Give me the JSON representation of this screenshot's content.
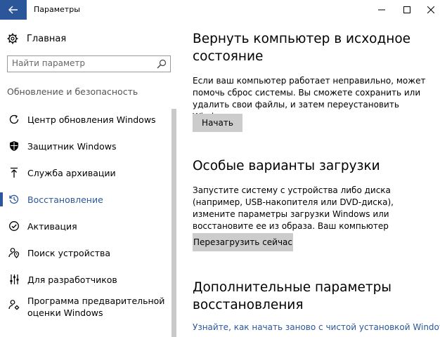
{
  "window": {
    "title": "Параметры",
    "accent": "#2b579a"
  },
  "sidebar": {
    "home_label": "Главная",
    "search_placeholder": "Найти параметр",
    "section_title": "Обновление и безопасность",
    "items": [
      {
        "label": "Центр обновления Windows",
        "icon": "refresh-icon"
      },
      {
        "label": "Защитник Windows",
        "icon": "shield-icon"
      },
      {
        "label": "Служба архивации",
        "icon": "upload-arrow-icon"
      },
      {
        "label": "Восстановление",
        "icon": "history-icon",
        "active": true
      },
      {
        "label": "Активация",
        "icon": "check-circle-icon"
      },
      {
        "label": "Поиск устройства",
        "icon": "person-pin-icon"
      },
      {
        "label": "Для разработчиков",
        "icon": "sliders-icon"
      },
      {
        "label": "Программа предварительной оценки Windows",
        "icon": "person-gear-icon"
      }
    ]
  },
  "main": {
    "reset": {
      "heading": "Вернуть компьютер в исходное состояние",
      "text": "Если ваш компьютер работает неправильно, может помочь сброс системы. Вы сможете сохранить или удалить свои файлы, и затем переустановить Windows.",
      "button": "Начать"
    },
    "advanced_startup": {
      "heading": "Особые варианты загрузки",
      "text": "Запустите систему с устройства либо диска (например, USB-накопителя или DVD-диска), измените параметры загрузки Windows или восстановите ее из образа. Ваш компьютер перезагрузится.",
      "button": "Перезагрузить сейчас"
    },
    "more_options": {
      "heading": "Дополнительные параметры восстановления",
      "link": "Узнайте, как начать заново с чистой установкой Windows"
    }
  }
}
